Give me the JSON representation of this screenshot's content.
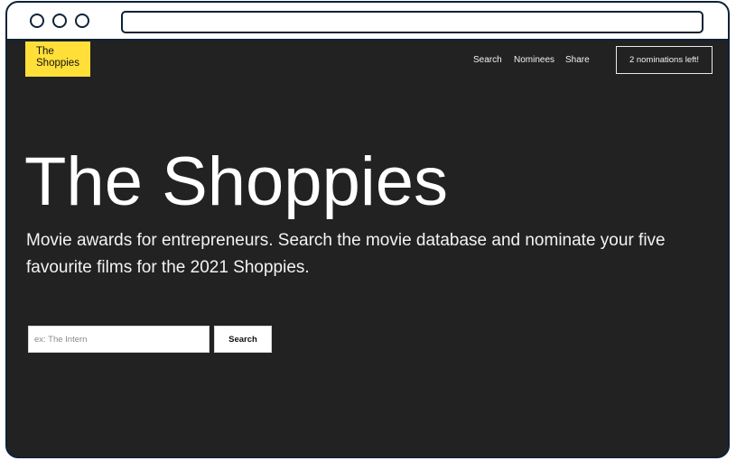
{
  "brand": {
    "line1": "The",
    "line2": "Shoppies",
    "color": "#ffdf38"
  },
  "nav": {
    "items": [
      "Search",
      "Nominees",
      "Share"
    ],
    "nominations_label": "2 nominations left!"
  },
  "hero": {
    "title": "The Shoppies",
    "subtitle": "Movie awards for entrepreneurs. Search the movie database and nominate your five favourite films for the 2021 Shoppies."
  },
  "search": {
    "placeholder": "ex: The Intern",
    "value": "",
    "button_label": "Search"
  },
  "colors": {
    "background": "#222222",
    "frame": "#0e2236"
  }
}
